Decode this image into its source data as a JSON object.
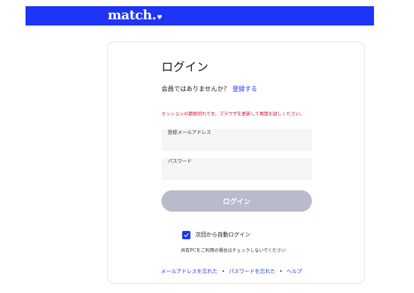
{
  "header": {
    "logo_text": "match.",
    "logo_heart": "♥",
    "brand_color": "#1e34f6"
  },
  "login": {
    "title": "ログイン",
    "no_account_text": "会員ではありませんか？",
    "signup_link": "登録する",
    "error_message": "セッションの期限切れです。ブラウザを更新して再度お試しください。",
    "error_color": "#c8102e",
    "email_label": "登録メールアドレス",
    "email_value": "",
    "password_label": "パスワード",
    "password_value": "",
    "login_button": "ログイン",
    "login_button_color": "#b9bbcb",
    "remember_checked": true,
    "remember_label": "次回から自動ログイン",
    "shared_pc_note": "共有PCをご利用の場合はチェックしないでください"
  },
  "footer": {
    "forgot_email": "メールアドレスを忘れた",
    "forgot_password": "パスワードを忘れた",
    "help": "ヘルプ",
    "separator": "•"
  },
  "icons": {
    "checkbox_check": "check-icon",
    "logo_heart": "heart-icon"
  }
}
